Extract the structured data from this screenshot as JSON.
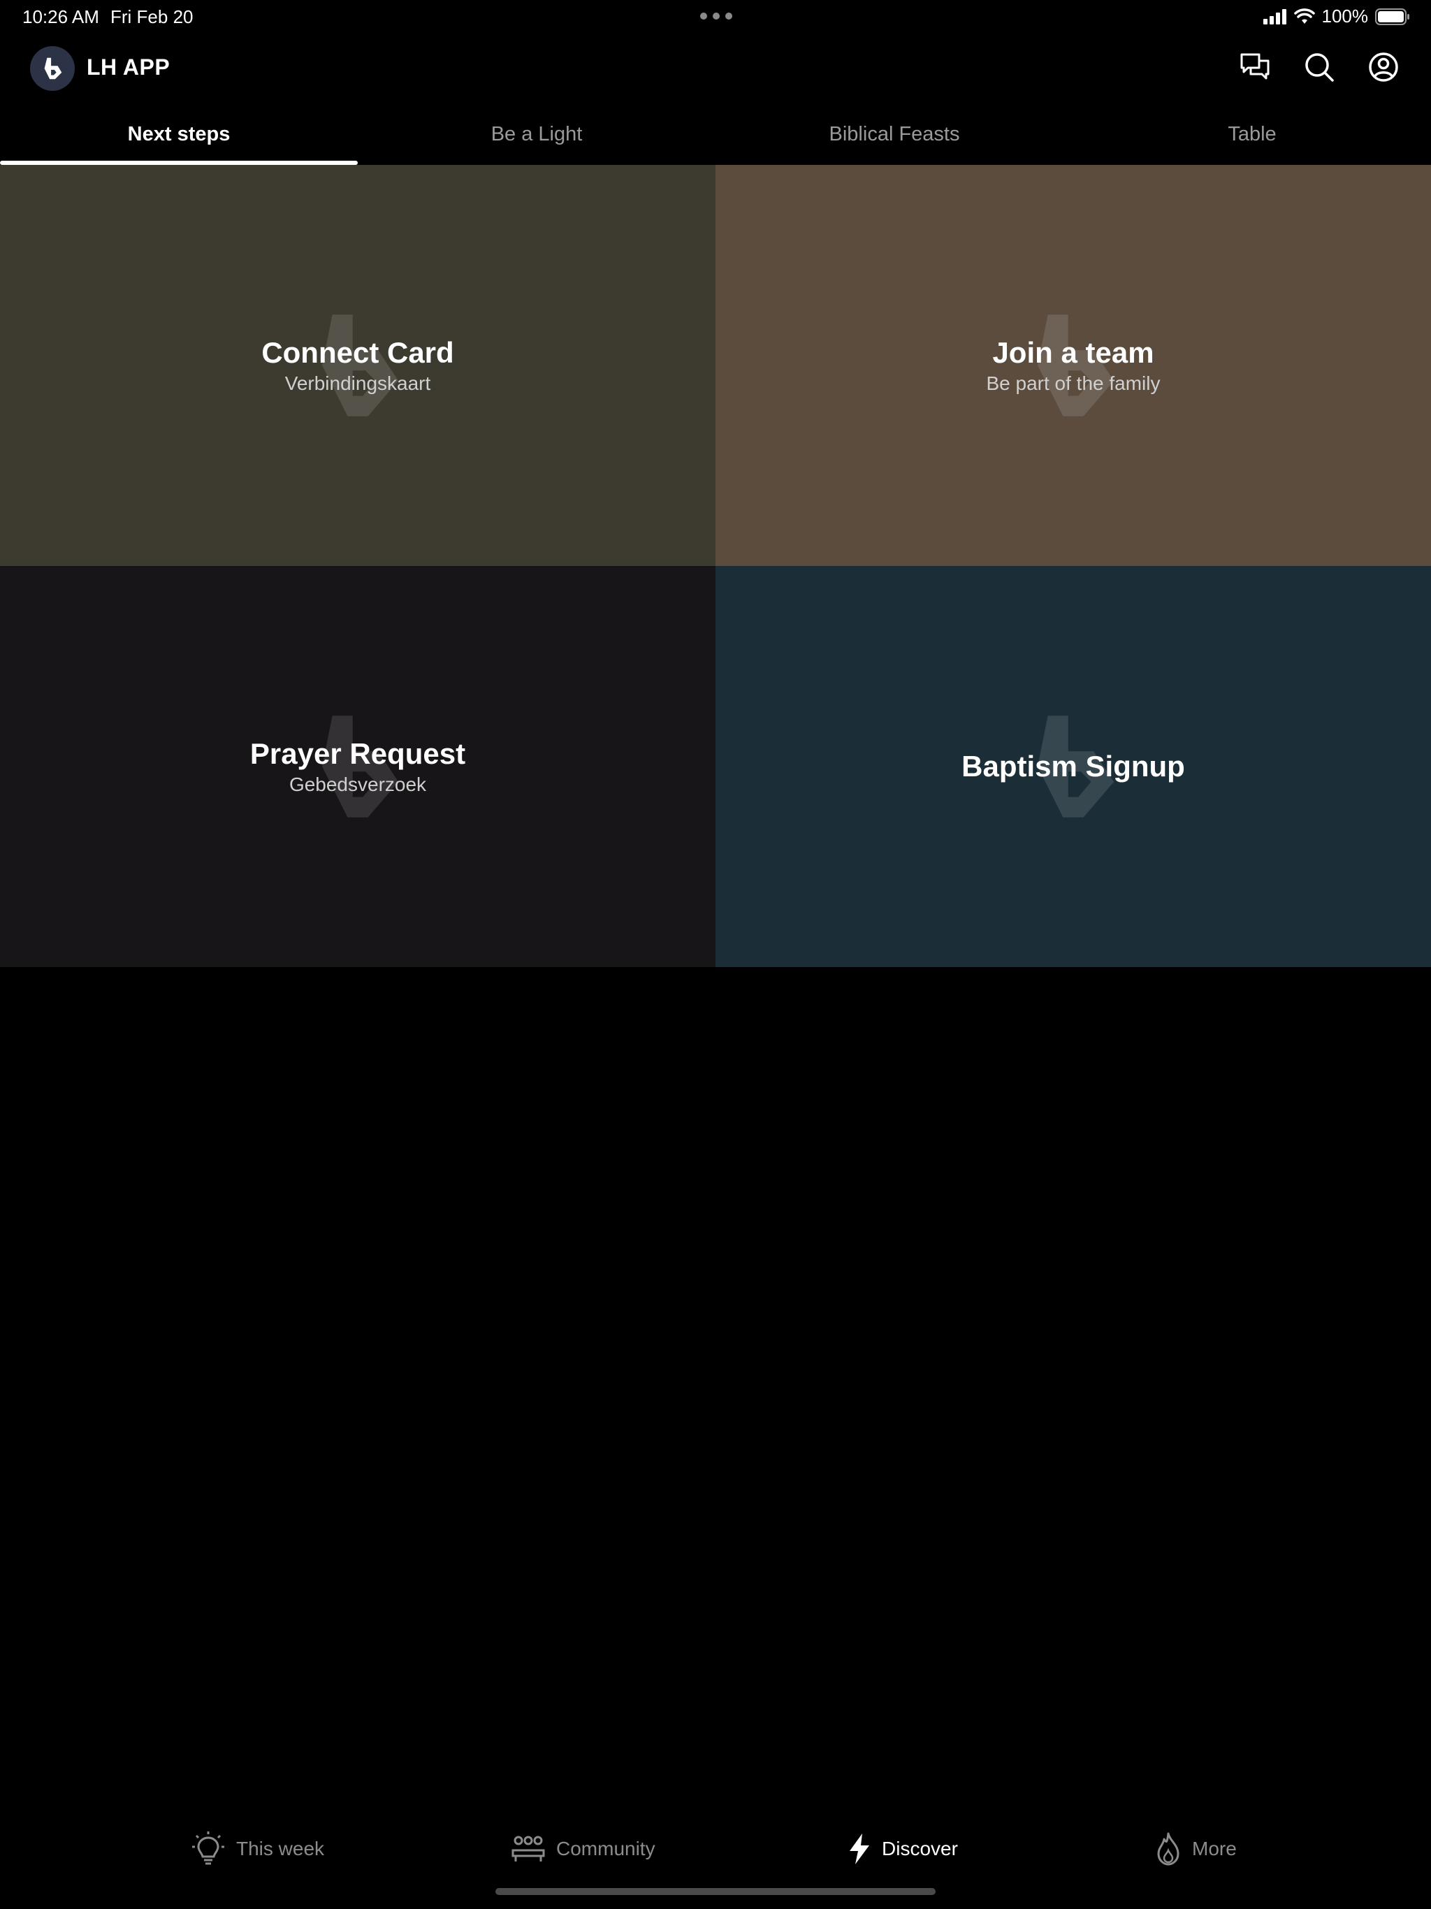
{
  "status_bar": {
    "time": "10:26 AM",
    "date": "Fri Feb 20",
    "battery": "100%"
  },
  "header": {
    "app_title": "LH APP",
    "icons": [
      "chat-icon",
      "search-icon",
      "account-icon"
    ]
  },
  "tabs": [
    {
      "label": "Next steps",
      "active": true
    },
    {
      "label": "Be a Light",
      "active": false
    },
    {
      "label": "Biblical Feasts",
      "active": false
    },
    {
      "label": "Table",
      "active": false
    }
  ],
  "cards": [
    {
      "title": "Connect Card",
      "subtitle": "Verbindingskaart",
      "color": "#3d3b30"
    },
    {
      "title": "Join a team",
      "subtitle": "Be part of the family",
      "color": "#5b4c3e"
    },
    {
      "title": "Prayer Request",
      "subtitle": "Gebedsverzoek",
      "color": "#171517"
    },
    {
      "title": "Baptism Signup",
      "subtitle": "",
      "color": "#1b2e38"
    }
  ],
  "bottom_nav": [
    {
      "label": "This week",
      "icon": "lightbulb-icon",
      "active": false
    },
    {
      "label": "Community",
      "icon": "community-icon",
      "active": false
    },
    {
      "label": "Discover",
      "icon": "lightning-icon",
      "active": true
    },
    {
      "label": "More",
      "icon": "flame-icon",
      "active": false
    }
  ]
}
